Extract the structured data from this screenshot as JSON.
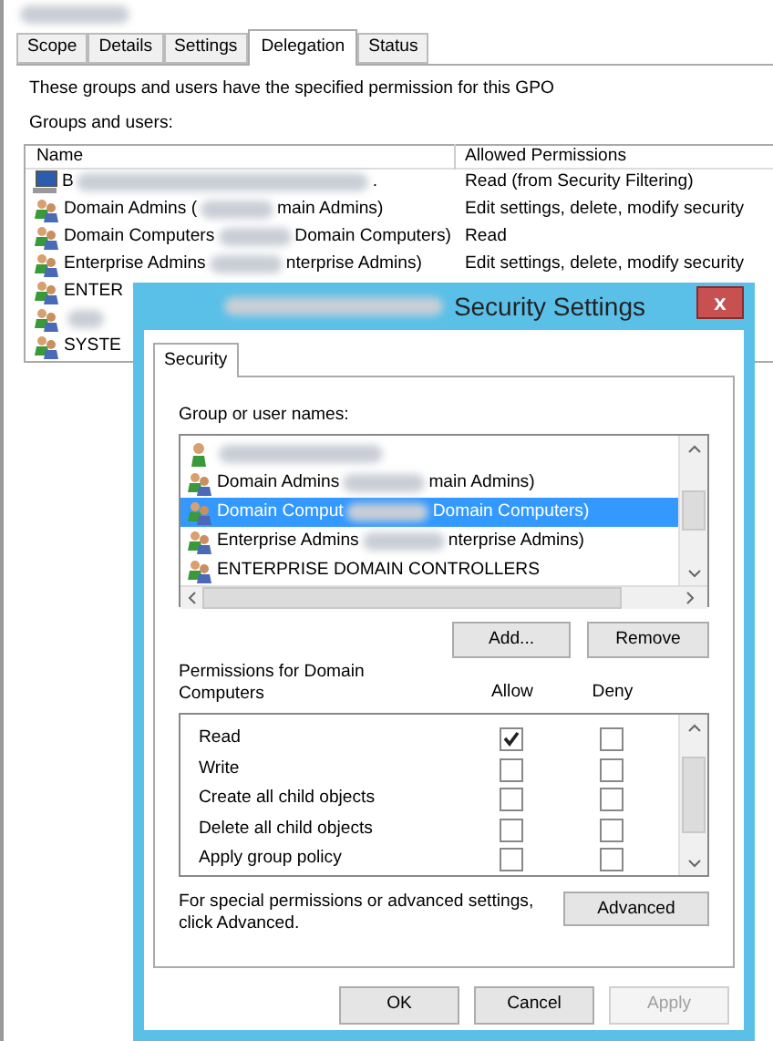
{
  "tabs": [
    {
      "label": "Scope",
      "selected": false
    },
    {
      "label": "Details",
      "selected": false
    },
    {
      "label": "Settings",
      "selected": false
    },
    {
      "label": "Delegation",
      "selected": true
    },
    {
      "label": "Status",
      "selected": false
    }
  ],
  "description": "These groups and users have the specified permission for this GPO",
  "groups_label": "Groups and users:",
  "table": {
    "columns": [
      "Name",
      "Allowed Permissions"
    ],
    "rows": [
      {
        "kind": "computer",
        "name_start": "B",
        "name_end": ".",
        "permission": "Read (from Security Filtering)"
      },
      {
        "kind": "group",
        "name_start": "Domain Admins (",
        "name_end": "main Admins)",
        "permission": "Edit settings, delete, modify security"
      },
      {
        "kind": "group",
        "name_start": "Domain Computers",
        "name_end": "Domain Computers)",
        "permission": "Read"
      },
      {
        "kind": "group",
        "name_start": "Enterprise Admins",
        "name_end": "nterprise Admins)",
        "permission": "Edit settings, delete, modify security"
      },
      {
        "kind": "group",
        "name_start": "ENTER"
      },
      {
        "kind": "group"
      },
      {
        "kind": "group",
        "name_start": "SYSTE"
      }
    ]
  },
  "dialog": {
    "title": "Security Settings",
    "close": "x",
    "tab": "Security",
    "names_label": "Group or user names:",
    "names": [
      {
        "kind": "user",
        "selected": false
      },
      {
        "kind": "group",
        "name_start": "Domain Admins",
        "name_end": "main Admins)",
        "selected": false
      },
      {
        "kind": "group",
        "name_start": "Domain Comput",
        "name_end": "Domain Computers)",
        "selected": true
      },
      {
        "kind": "group",
        "name_start": "Enterprise Admins",
        "name_end": "nterprise Admins)",
        "selected": false
      },
      {
        "kind": "group",
        "name_start": "ENTERPRISE DOMAIN CONTROLLERS",
        "selected": false
      }
    ],
    "add_button": "Add...",
    "remove_button": "Remove",
    "permissions_label": "Permissions for Domain Computers",
    "allow_label": "Allow",
    "deny_label": "Deny",
    "permissions": [
      {
        "name": "Read",
        "allow": true,
        "deny": false
      },
      {
        "name": "Write",
        "allow": false,
        "deny": false
      },
      {
        "name": "Create all child objects",
        "allow": false,
        "deny": false
      },
      {
        "name": "Delete all child objects",
        "allow": false,
        "deny": false
      },
      {
        "name": "Apply group policy",
        "allow": false,
        "deny": false
      }
    ],
    "advanced_note": "For special permissions or advanced settings, click Advanced.",
    "advanced_button": "Advanced",
    "buttons": [
      {
        "label": "OK",
        "disabled": false
      },
      {
        "label": "Cancel",
        "disabled": false
      },
      {
        "label": "Apply",
        "disabled": true
      }
    ]
  }
}
